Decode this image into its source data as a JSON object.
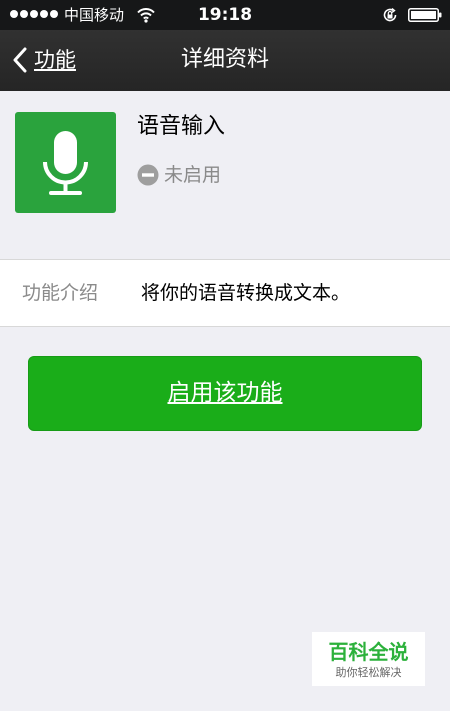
{
  "status_bar": {
    "carrier": "中国移动",
    "time": "19:18",
    "signal_dots": 5,
    "icons": [
      "signal-icon",
      "wifi-icon",
      "rotation-lock-icon",
      "battery-icon"
    ]
  },
  "nav": {
    "back_label": "功能",
    "back_icon": "chevron-left-icon",
    "title": "详细资料"
  },
  "feature": {
    "icon": "microphone-icon",
    "icon_color": "#2aa33d",
    "name": "语音输入",
    "status_icon": "disabled-icon",
    "status_text": "未启用"
  },
  "intro": {
    "label": "功能介绍",
    "value": "将你的语音转换成文本。"
  },
  "actions": {
    "enable_label": "启用该功能",
    "enable_color": "#1aad19"
  },
  "watermark": {
    "title": "百科全说",
    "subtitle": "助你轻松解决"
  }
}
